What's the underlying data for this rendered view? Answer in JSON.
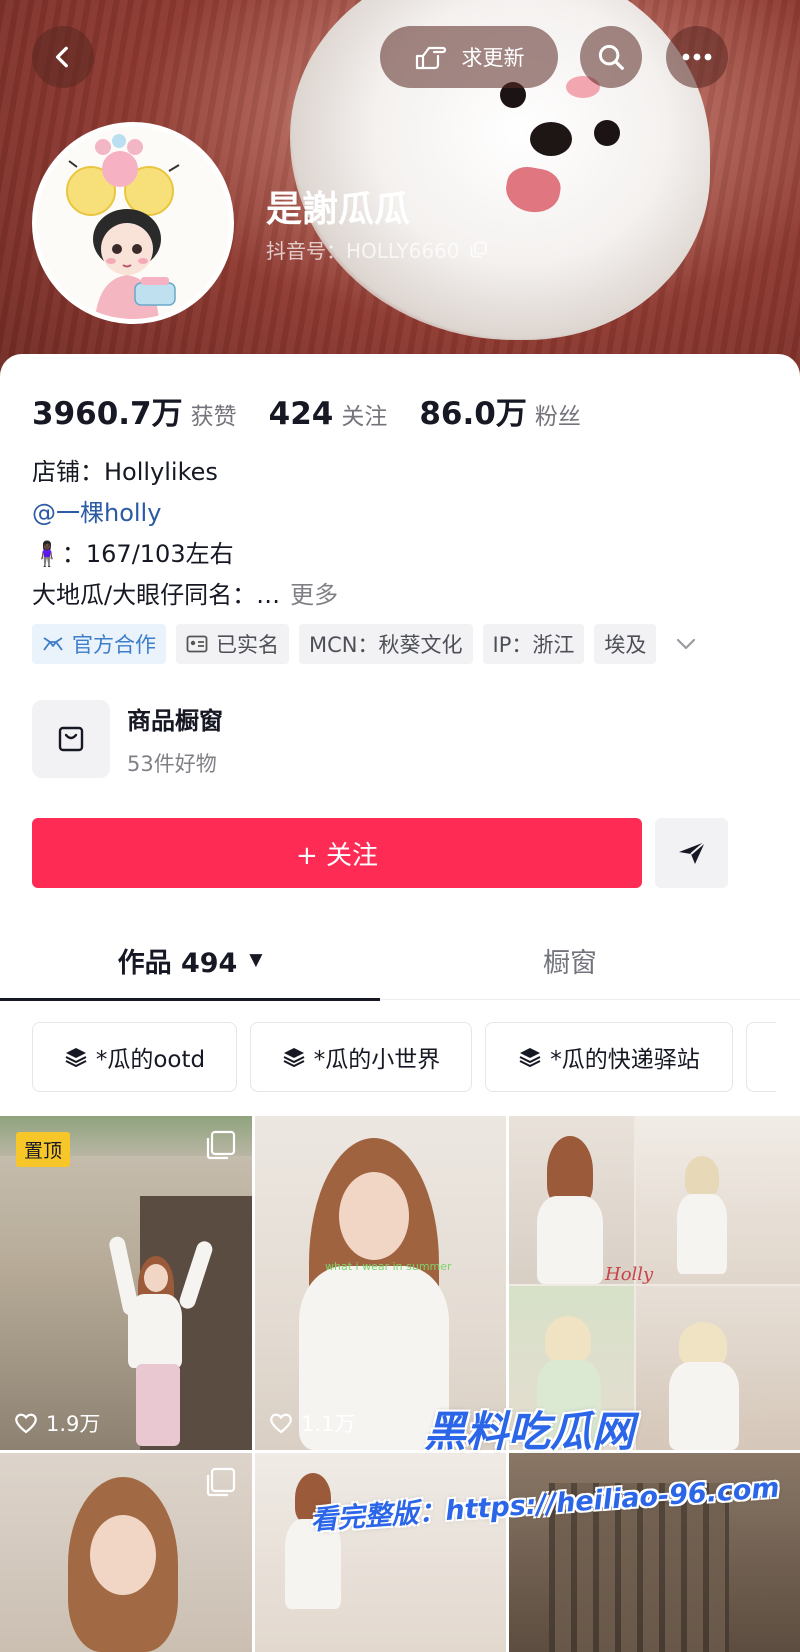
{
  "header": {
    "back_icon": "back-chevron-icon",
    "request_update_label": "求更新",
    "request_update_icon": "pointing-hand-icon",
    "search_icon": "search-icon",
    "more_icon": "more-dots-icon"
  },
  "profile": {
    "name": "是謝瓜瓜",
    "douyin_id": "抖音号：HOLLY6660",
    "copy_icon": "copy-icon"
  },
  "stats": [
    {
      "value": "3960.7万",
      "label": "获赞"
    },
    {
      "value": "424",
      "label": "关注"
    },
    {
      "value": "86.0万",
      "label": "粉丝"
    }
  ],
  "bio": {
    "line1": "店铺：Hollylikes",
    "line2": "@一棵holly",
    "line3_emoji": "🧍🏿‍♀️",
    "line3_text": "：167/103左右",
    "line4": "大地瓜/大眼仔同名：…",
    "more": "更多"
  },
  "tags": {
    "official": "官方合作",
    "verified": "已实名",
    "mcn": "MCN：秋葵文化",
    "ip": "IP：浙江",
    "location": "埃及"
  },
  "shop": {
    "title": "商品橱窗",
    "subtitle": "53件好物"
  },
  "actions": {
    "follow": "+ 关注",
    "share_icon": "send-icon"
  },
  "tabs": {
    "works": "作品 494",
    "works_arrow": "▼",
    "window": "橱窗"
  },
  "collections": [
    "*瓜的ootd",
    "*瓜的小世界",
    "*瓜的快递驿站"
  ],
  "grid": {
    "pinned_label": "置顶",
    "items": [
      {
        "likes": "1.9万"
      },
      {
        "likes": "1.1万"
      }
    ],
    "caption": "what i wear in summer",
    "sign": "Holly"
  },
  "watermark": {
    "line1": "黑料吃瓜网",
    "line2": "看完整版：https://heiliao-96.com"
  },
  "colors": {
    "accent": "#fe2c55",
    "link": "#2b5aa6",
    "official": "#3d7ec9",
    "pin": "#f7c72a"
  }
}
